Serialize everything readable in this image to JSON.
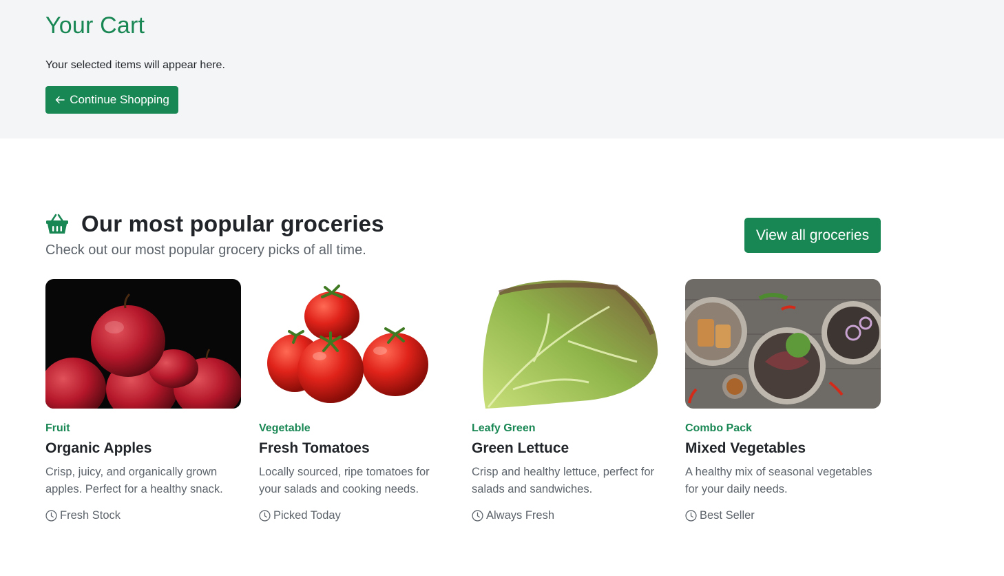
{
  "cart": {
    "title": "Your Cart",
    "text": "Your selected items will appear here.",
    "continue_label": "Continue Shopping",
    "continue_icon": "arrow-left-icon"
  },
  "popular": {
    "icon": "basket-icon",
    "title": "Our most popular groceries",
    "subtitle": "Check out our most popular grocery picks of all time.",
    "view_all_label": "View all groceries"
  },
  "products": [
    {
      "category": "Fruit",
      "name": "Organic Apples",
      "description": "Crisp, juicy, and organically grown apples. Perfect for a healthy snack.",
      "meta": "Fresh Stock",
      "image": "apples-image"
    },
    {
      "category": "Vegetable",
      "name": "Fresh Tomatoes",
      "description": "Locally sourced, ripe tomatoes for your salads and cooking needs.",
      "meta": "Picked Today",
      "image": "tomatoes-image"
    },
    {
      "category": "Leafy Green",
      "name": "Green Lettuce",
      "description": "Crisp and healthy lettuce, perfect for salads and sandwiches.",
      "meta": "Always Fresh",
      "image": "lettuce-image"
    },
    {
      "category": "Combo Pack",
      "name": "Mixed Vegetables",
      "description": "A healthy mix of seasonal vegetables for your daily needs.",
      "meta": "Best Seller",
      "image": "mixed-vegetables-image"
    }
  ],
  "colors": {
    "accent": "#198754",
    "hero_bg": "#f4f5f7",
    "muted_text": "#5c636a"
  }
}
